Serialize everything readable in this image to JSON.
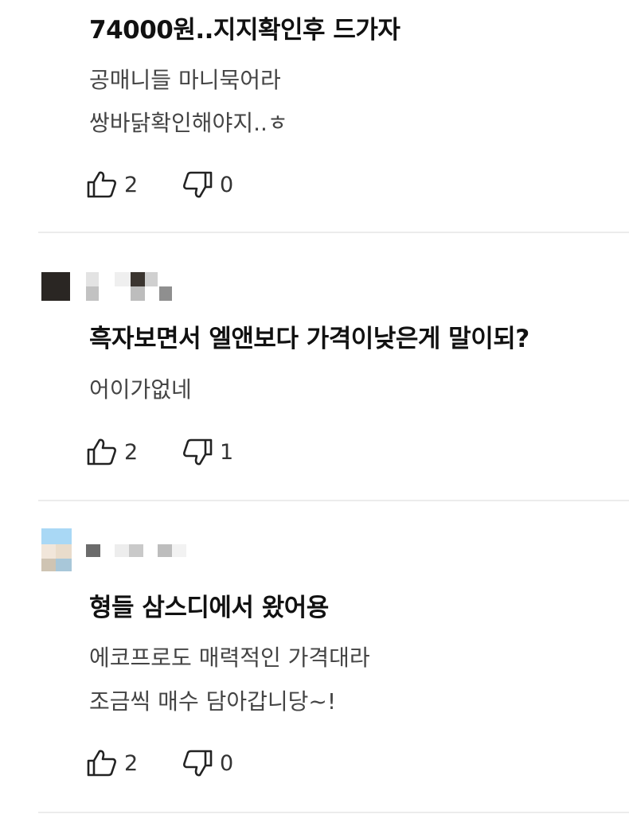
{
  "comments": [
    {
      "title": "74000원..지지확인후 드가자",
      "body": [
        "공매니들 마니묵어라",
        "쌍바닭확인해야지..ㅎ"
      ],
      "likes": "2",
      "dislikes": "0",
      "avatar_colors": []
    },
    {
      "title": "흑자보면서 엘앤보다 가격이낮은게 말이되?",
      "body": [
        "어이가없네"
      ],
      "likes": "2",
      "dislikes": "1",
      "avatar_colors": [
        "#2a2623",
        "#3b3530",
        "#6a605a"
      ]
    },
    {
      "title": "형들 삼스디에서 왔어용",
      "body": [
        "에코프로도 매력적인 가격대라",
        "조금씩 매수 담아갑니당~!"
      ],
      "likes": "2",
      "dislikes": "0",
      "avatar_colors": [
        "#a9d8f5",
        "#e9dccb",
        "#cfc4b3",
        "#a8c7d9"
      ]
    }
  ],
  "colors": {
    "title": "#111111",
    "body": "#444444",
    "divider": "#ececec",
    "icon": "#222222"
  },
  "icons": [
    "thumbs-up-icon",
    "thumbs-down-icon"
  ]
}
